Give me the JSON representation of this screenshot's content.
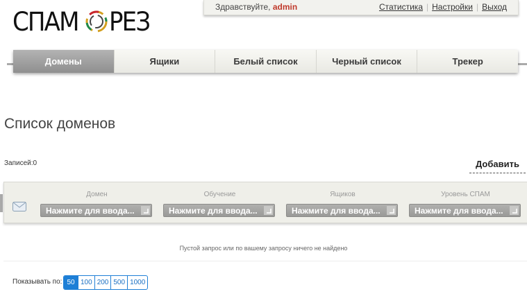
{
  "logo": {
    "part1": "СПАМ",
    "part2": "РЕЗ"
  },
  "userbar": {
    "greeting": "Здравствуйте,",
    "username": "admin",
    "links": [
      "Статистика",
      "Настройки",
      "Выход"
    ]
  },
  "nav": {
    "tabs": [
      {
        "label": "Домены",
        "active": true
      },
      {
        "label": "Ящики",
        "active": false
      },
      {
        "label": "Белый список",
        "active": false
      },
      {
        "label": "Черный список",
        "active": false
      },
      {
        "label": "Трекер",
        "active": false
      }
    ]
  },
  "page": {
    "title": "Список доменов",
    "count_label": "Записей:0",
    "add_button": "Добавить"
  },
  "table": {
    "columns": [
      "Домен",
      "Обучение",
      "Ящиков",
      "Уровень СПАМ"
    ],
    "filter_placeholder": "Нажмите для ввода...",
    "empty_text": "Пустой запрос или по вашему запросу ничего не найдено"
  },
  "pager": {
    "label": "Показывать по:",
    "options": [
      "50",
      "100",
      "200",
      "500",
      "1000"
    ],
    "selected": "50"
  },
  "colors": {
    "accent": "#1e7fd6",
    "username": "#c0392b",
    "active_tab": "#999999"
  }
}
